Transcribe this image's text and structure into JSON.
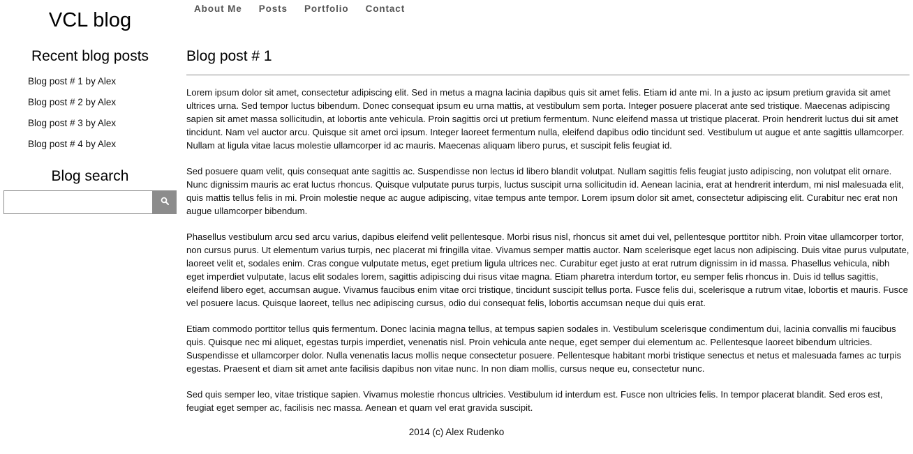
{
  "sidebar": {
    "site_title": "VCL blog",
    "recent_title": "Recent blog posts",
    "recent_posts": [
      "Blog post # 1 by Alex",
      "Blog post # 2 by Alex",
      "Blog post # 3 by Alex",
      "Blog post # 4 by Alex"
    ],
    "search_title": "Blog search",
    "search": {
      "value": "",
      "placeholder": "",
      "button_icon": "search-icon"
    }
  },
  "nav": {
    "items": [
      "About Me",
      "Posts",
      "Portfolio",
      "Contact"
    ]
  },
  "post": {
    "title": "Blog post # 1",
    "paragraphs": [
      "Lorem ipsum dolor sit amet, consectetur adipiscing elit. Sed in metus a magna lacinia dapibus quis sit amet felis. Etiam id ante mi. In a justo ac ipsum pretium gravida sit amet ultrices urna. Sed tempor luctus bibendum. Donec consequat ipsum eu urna mattis, at vestibulum sem porta. Integer posuere placerat ante sed tristique. Maecenas adipiscing sapien sit amet massa sollicitudin, at lobortis ante vehicula. Proin sagittis orci ut pretium fermentum. Nunc eleifend massa ut tristique placerat. Proin hendrerit luctus dui sit amet tincidunt. Nam vel auctor arcu. Quisque sit amet orci ipsum. Integer laoreet fermentum nulla, eleifend dapibus odio tincidunt sed. Vestibulum ut augue et ante sagittis ullamcorper. Nullam at ligula vitae lacus molestie ullamcorper id ac mauris. Maecenas aliquam libero purus, et suscipit felis feugiat id.",
      "Sed posuere quam velit, quis consequat ante sagittis ac. Suspendisse non lectus id libero blandit volutpat. Nullam sagittis felis feugiat justo adipiscing, non volutpat elit ornare. Nunc dignissim mauris ac erat luctus rhoncus. Quisque vulputate purus turpis, luctus suscipit urna sollicitudin id. Aenean lacinia, erat at hendrerit interdum, mi nisl malesuada elit, quis mattis tellus felis in mi. Proin molestie neque ac augue adipiscing, vitae tempus ante tempor. Lorem ipsum dolor sit amet, consectetur adipiscing elit. Curabitur nec erat non augue ullamcorper bibendum.",
      "Phasellus vestibulum arcu sed arcu varius, dapibus eleifend velit pellentesque. Morbi risus nisl, rhoncus sit amet dui vel, pellentesque porttitor nibh. Proin vitae ullamcorper tortor, non cursus purus. Ut elementum varius turpis, nec placerat mi fringilla vitae. Vivamus semper mattis auctor. Nam scelerisque eget lacus non adipiscing. Duis vitae purus vulputate, laoreet velit et, sodales enim. Cras congue vulputate metus, eget pretium ligula ultrices nec. Curabitur eget justo at erat rutrum dignissim in id massa. Phasellus vehicula, nibh eget imperdiet vulputate, lacus elit sodales lorem, sagittis adipiscing dui risus vitae magna. Etiam pharetra interdum tortor, eu semper felis rhoncus in. Duis id tellus sagittis, eleifend libero eget, accumsan augue. Vivamus faucibus enim vitae orci tristique, tincidunt suscipit tellus porta. Fusce felis dui, scelerisque a rutrum vitae, lobortis et mauris. Fusce vel posuere lacus. Quisque laoreet, tellus nec adipiscing cursus, odio dui consequat felis, lobortis accumsan neque dui quis erat.",
      "Etiam commodo porttitor tellus quis fermentum. Donec lacinia magna tellus, at tempus sapien sodales in. Vestibulum scelerisque condimentum dui, lacinia convallis mi faucibus quis. Quisque nec mi aliquet, egestas turpis imperdiet, venenatis nisl. Proin vehicula ante neque, eget semper dui elementum ac. Pellentesque laoreet bibendum ultricies. Suspendisse et ullamcorper dolor. Nulla venenatis lacus mollis neque consectetur posuere. Pellentesque habitant morbi tristique senectus et netus et malesuada fames ac turpis egestas. Praesent et diam sit amet ante facilisis dapibus non vitae nunc. In non diam mollis, cursus neque eu, consectetur nunc.",
      "Sed quis semper leo, vitae tristique sapien. Vivamus molestie rhoncus ultricies. Vestibulum id interdum est. Fusce non ultricies felis. In tempor placerat blandit. Sed eros est, feugiat eget semper ac, facilisis nec massa. Aenean et quam vel erat gravida suscipit."
    ]
  },
  "footer": {
    "text": "2014 (c) Alex Rudenko"
  }
}
